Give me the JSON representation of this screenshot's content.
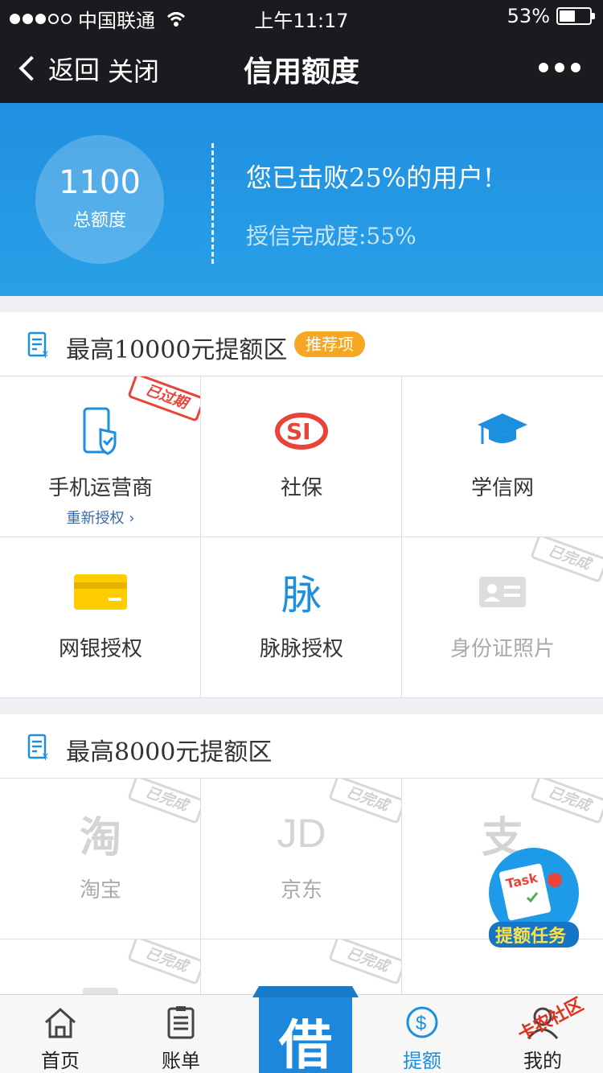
{
  "status_bar": {
    "carrier": "中国联通",
    "time": "上午11:17",
    "battery": "53%",
    "battery_level": 0.53
  },
  "nav": {
    "back_label": "返回",
    "close_label": "关闭",
    "title": "信用额度"
  },
  "credit": {
    "amount": "1100",
    "amount_label": "总额度",
    "beat_text": "您已击败25%的用户!",
    "completion_text": "授信完成度:55%"
  },
  "section1": {
    "title": "最高10000元提额区",
    "badge": "推荐项",
    "items": [
      {
        "name": "手机运营商",
        "sub": "重新授权 ›",
        "stamp": "已过期",
        "icon": "phone-shield-icon"
      },
      {
        "name": "社保",
        "icon": "social-security-icon"
      },
      {
        "name": "学信网",
        "icon": "graduation-cap-icon"
      },
      {
        "name": "网银授权",
        "icon": "bank-card-icon"
      },
      {
        "name": "脉脉授权",
        "icon": "maimai-icon",
        "glyph": "脉"
      },
      {
        "name": "身份证照片",
        "stamp": "已完成",
        "icon": "id-card-icon"
      }
    ]
  },
  "section2": {
    "title": "最高8000元提额区",
    "items": [
      {
        "name": "淘宝",
        "stamp": "已完成",
        "icon": "taobao-icon",
        "glyph": "淘"
      },
      {
        "name": "京东",
        "stamp": "已完成",
        "icon": "jd-icon",
        "glyph": "JD"
      },
      {
        "name": "支",
        "stamp": "已完成",
        "icon": "alipay-icon",
        "glyph": "支"
      },
      {
        "name": "",
        "stamp": "已完成",
        "icon": "yuan-card-icon"
      },
      {
        "name": "",
        "stamp": "已完成",
        "icon": "card-icon"
      },
      {
        "name": ""
      }
    ]
  },
  "task_float": {
    "label": "提额任务",
    "tag": "Task"
  },
  "tabs": [
    {
      "label": "首页",
      "icon": "home-icon"
    },
    {
      "label": "账单",
      "icon": "bill-icon"
    },
    {
      "label": "借",
      "icon": "borrow-icon"
    },
    {
      "label": "提额",
      "icon": "dollar-circle-icon",
      "active": true
    },
    {
      "label": "我的",
      "icon": "user-icon"
    }
  ],
  "watermark": "卡农社区",
  "colors": {
    "accent": "#1d8fdf",
    "badge": "#f5a623",
    "stamp_red": "#e9443a"
  }
}
